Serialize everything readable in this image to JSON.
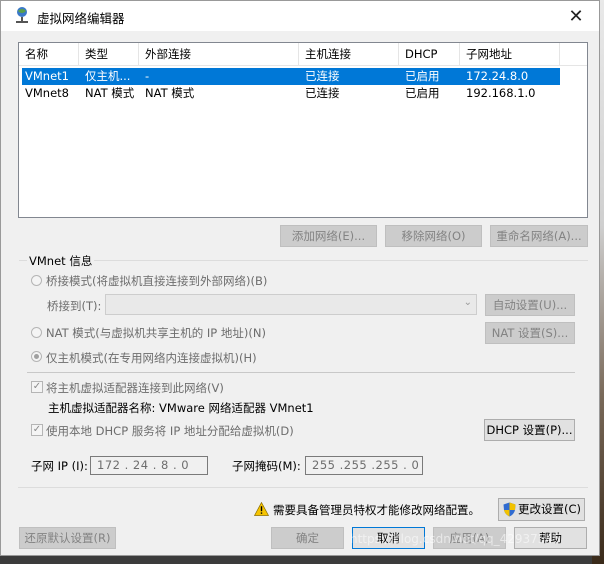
{
  "window": {
    "title": "虚拟网络编辑器",
    "close_glyph": "✕"
  },
  "table": {
    "columns": [
      "名称",
      "类型",
      "外部连接",
      "主机连接",
      "DHCP",
      "子网地址"
    ],
    "rows": [
      {
        "name": "VMnet1",
        "type": "仅主机...",
        "external": "-",
        "host": "已连接",
        "dhcp": "已启用",
        "subnet": "172.24.8.0"
      },
      {
        "name": "VMnet8",
        "type": "NAT 模式",
        "external": "NAT 模式",
        "host": "已连接",
        "dhcp": "已启用",
        "subnet": "192.168.1.0"
      }
    ]
  },
  "list_buttons": {
    "add": "添加网络(E)...",
    "remove": "移除网络(O)",
    "rename": "重命名网络(A)..."
  },
  "vmnet_info": {
    "label": "VMnet 信息",
    "bridged": "桥接模式(将虚拟机直接连接到外部网络)(B)",
    "bridge_to": "桥接到(T):",
    "auto_settings": "自动设置(U)...",
    "nat": "NAT 模式(与虚拟机共享主机的 IP 地址)(N)",
    "nat_settings": "NAT 设置(S)...",
    "host_only": "仅主机模式(在专用网络内连接虚拟机)(H)",
    "connect_adapter": "将主机虚拟适配器连接到此网络(V)",
    "adapter_name": "主机虚拟适配器名称: VMware 网络适配器 VMnet1",
    "use_dhcp": "使用本地 DHCP 服务将 IP 地址分配给虚拟机(D)",
    "dhcp_settings": "DHCP 设置(P)...",
    "subnet_ip_label": "子网 IP (I):",
    "subnet_ip": "172 . 24 . 8 . 0",
    "subnet_mask_label": "子网掩码(M):",
    "subnet_mask": "255 .255 .255 . 0"
  },
  "admin": {
    "warning": "需要具备管理员特权才能修改网络配置。",
    "change_settings": "更改设置(C)"
  },
  "footer": {
    "restore": "还原默认设置(R)",
    "ok": "确定",
    "cancel": "取消",
    "apply": "应用(A)",
    "help": "帮助"
  },
  "watermark": "https://blog.csdn.net/qq_42937545",
  "colors": {
    "selection": "#0078d7",
    "warning": "#f6c400"
  }
}
